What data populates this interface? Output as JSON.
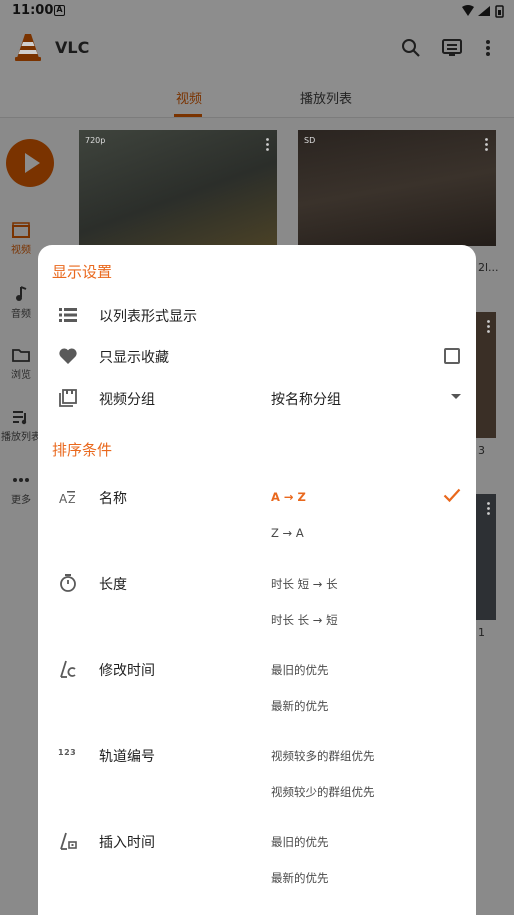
{
  "status_bar": {
    "time": "11:00",
    "notification_icon": "A"
  },
  "app_bar": {
    "title": "VLC",
    "icons": [
      "search-icon",
      "rendering-cast-icon",
      "more-vert-icon"
    ]
  },
  "tabs": [
    {
      "label": "视频",
      "active": true
    },
    {
      "label": "播放列表",
      "active": false
    }
  ],
  "side_nav": [
    {
      "label": "视频",
      "icon": "video-clapper-icon",
      "active": true
    },
    {
      "label": "音频",
      "icon": "music-note-icon",
      "active": false
    },
    {
      "label": "浏览",
      "icon": "folder-icon",
      "active": false
    },
    {
      "label": "播放列表",
      "icon": "playlist-icon",
      "active": false
    },
    {
      "label": "更多",
      "icon": "more-horiz-icon",
      "active": false
    }
  ],
  "videos": [
    {
      "badge": "720p"
    },
    {
      "badge": "SD"
    }
  ],
  "peek_text": {
    "title_peek": "2l...",
    "digit_peek_1": "3",
    "digit_peek_2": "1"
  },
  "display_settings": {
    "title": "显示设置",
    "rows": [
      {
        "label": "以列表形式显示",
        "icon": "list-view-icon"
      },
      {
        "label": "只显示收藏",
        "icon": "heart-icon",
        "checked": false
      },
      {
        "label": "视频分组",
        "icon": "video-group-icon",
        "value": "按名称分组"
      }
    ]
  },
  "sort_settings": {
    "title": "排序条件",
    "criteria": [
      {
        "label": "名称",
        "icon": "sort-alpha-icon",
        "options": [
          "A → Z",
          "Z → A"
        ],
        "selected": 0
      },
      {
        "label": "长度",
        "icon": "timer-icon",
        "options": [
          "时长 短 → 长",
          "时长 长 → 短"
        ],
        "selected": -1
      },
      {
        "label": "修改时间",
        "icon": "modified-date-icon",
        "options": [
          "最旧的优先",
          "最新的优先"
        ],
        "selected": -1
      },
      {
        "label": "轨道编号",
        "icon": "track-number-icon",
        "icon_text": "123",
        "options": [
          "视频较多的群组优先",
          "视频较少的群组优先"
        ],
        "selected": -1
      },
      {
        "label": "插入时间",
        "icon": "insertion-date-icon",
        "options": [
          "最旧的优先",
          "最新的优先"
        ],
        "selected": -1
      }
    ]
  },
  "colors": {
    "accent": "#e9681d",
    "scrim": "#8d8d8d",
    "sheet": "#ffffff"
  }
}
